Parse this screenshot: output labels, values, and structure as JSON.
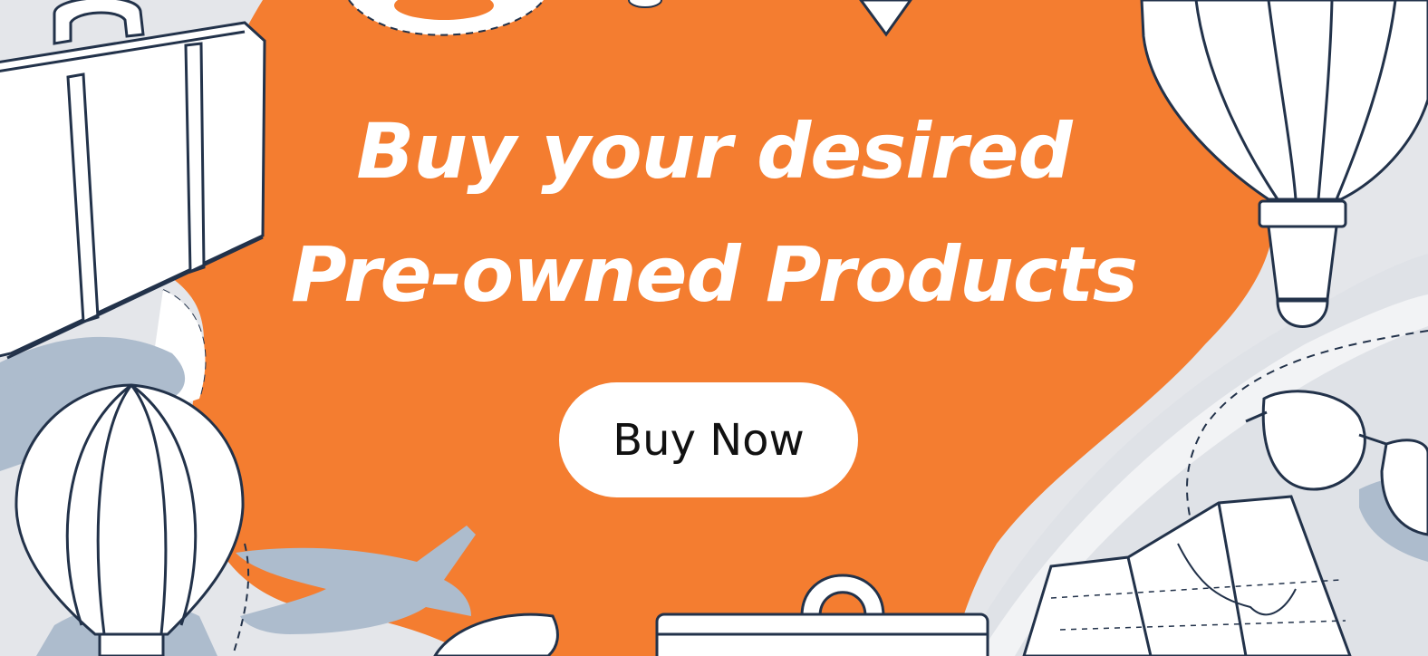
{
  "banner": {
    "headline_line1": "Buy your desired",
    "headline_line2": "Pre-owned Products",
    "cta_label": "Buy Now"
  },
  "colors": {
    "accent": "#f47d30",
    "background": "#e4e6ea",
    "shadow": "#adbccd",
    "ink": "#22324a",
    "text": "#ffffff",
    "button": "#ffffff",
    "button_text": "#111111"
  },
  "decorations": [
    "suitcase-illustration",
    "hot-air-balloon-illustration",
    "airplane-shadow",
    "sunglasses-illustration",
    "folded-map-illustration",
    "dashed-flight-path",
    "location-pin-illustration"
  ]
}
